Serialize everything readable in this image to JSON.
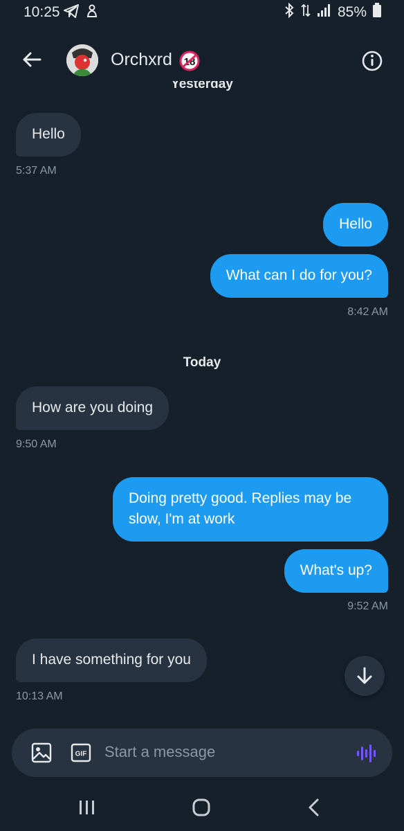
{
  "status_bar": {
    "time": "10:25",
    "battery": "85%"
  },
  "header": {
    "contact_name": "Orchxrd",
    "badge": "18"
  },
  "conversation": {
    "date_yesterday": "Yesterday",
    "date_today": "Today",
    "messages": [
      {
        "direction": "incoming",
        "text": "Hello"
      },
      {
        "direction": "outgoing",
        "text": "Hello"
      },
      {
        "direction": "outgoing",
        "text": "What can I do for you?"
      },
      {
        "direction": "incoming",
        "text": "How are you doing"
      },
      {
        "direction": "outgoing",
        "text": "Doing pretty good. Replies may be slow, I'm at work"
      },
      {
        "direction": "outgoing",
        "text": "What's up?"
      },
      {
        "direction": "incoming",
        "text": "I have something for you"
      }
    ],
    "timestamps": [
      "5:37 AM",
      "8:42 AM",
      "9:50 AM",
      "9:52 AM",
      "10:13 AM"
    ]
  },
  "composer": {
    "placeholder": "Start a message",
    "gif_label": "GIF"
  },
  "colors": {
    "background": "#15202b",
    "incoming_bubble": "#273340",
    "outgoing_bubble": "#1d9bf0",
    "voice_accent": "#7856ff"
  }
}
